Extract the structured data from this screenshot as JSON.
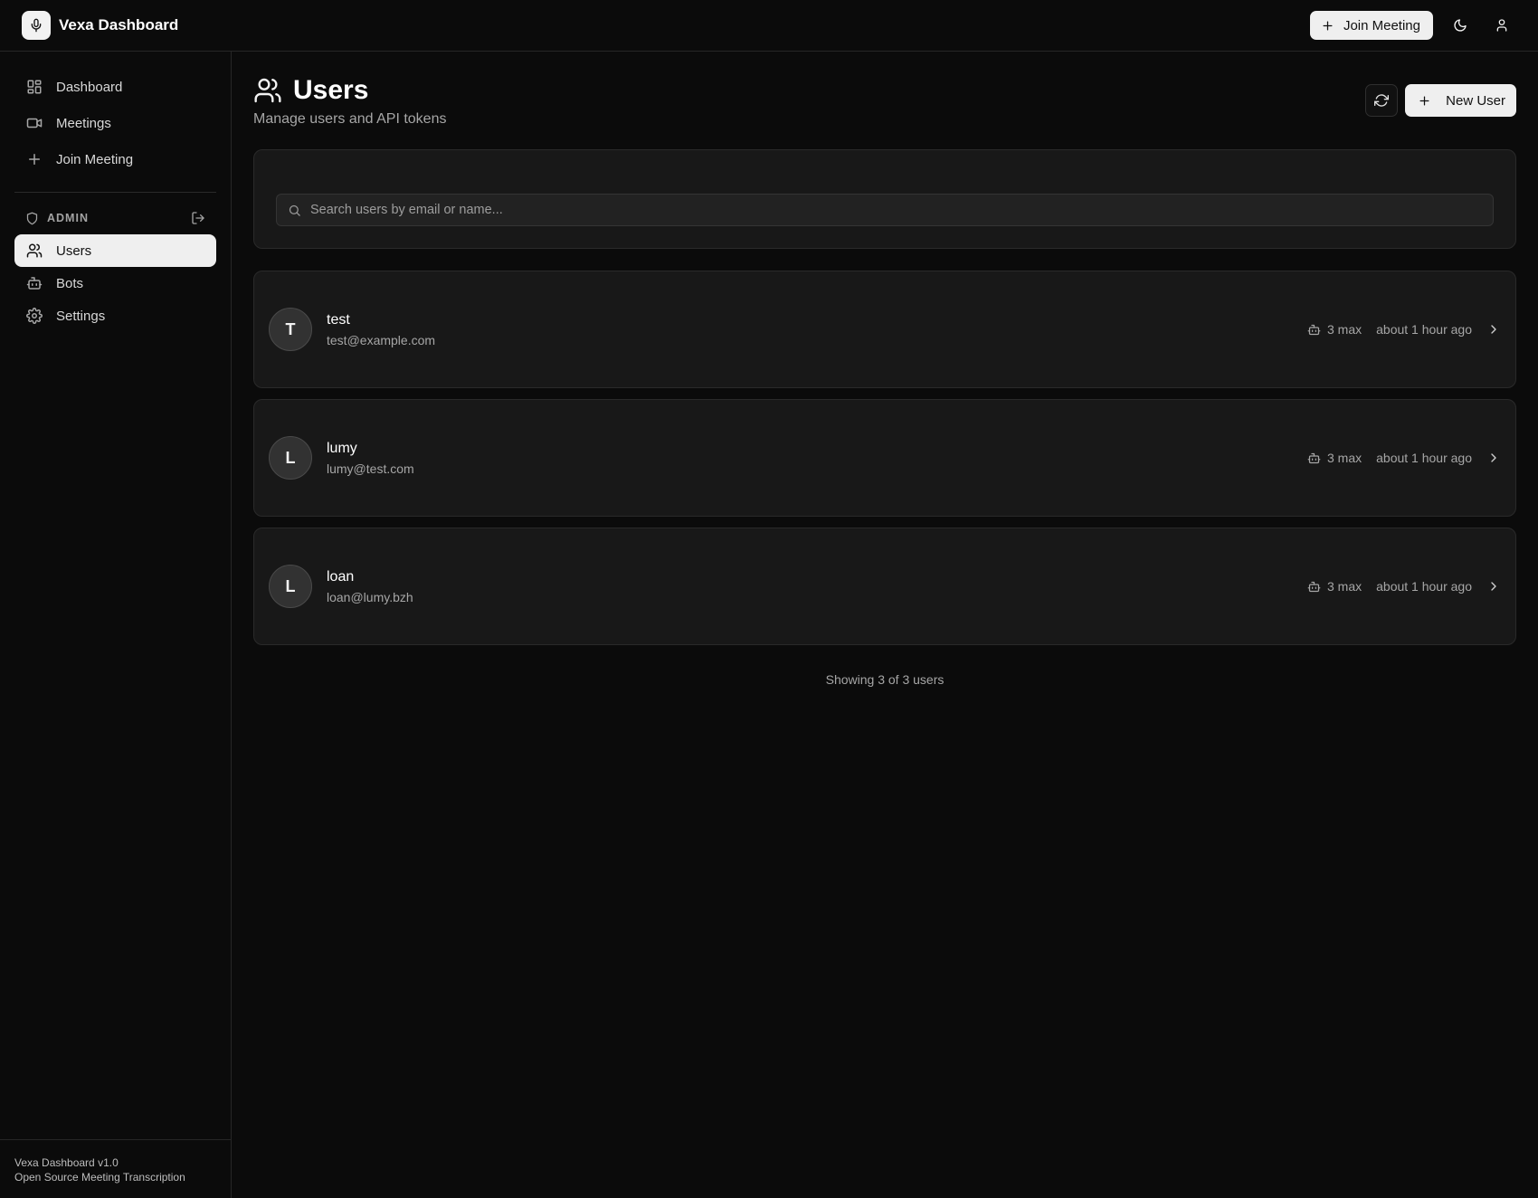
{
  "header": {
    "app_title": "Vexa Dashboard",
    "logo_icon": "microphone-icon",
    "join_meeting_label": "Join Meeting",
    "theme_icon": "moon-icon",
    "user_icon": "user-icon"
  },
  "sidebar": {
    "items": [
      {
        "label": "Dashboard",
        "icon": "dashboard-icon"
      },
      {
        "label": "Meetings",
        "icon": "video-icon"
      },
      {
        "label": "Join Meeting",
        "icon": "plus-icon"
      }
    ],
    "admin_label": "ADMIN",
    "admin_items": [
      {
        "label": "Users",
        "icon": "users-icon",
        "active": true
      },
      {
        "label": "Bots",
        "icon": "bot-icon"
      },
      {
        "label": "Settings",
        "icon": "gear-icon"
      }
    ],
    "footer": {
      "version": "Vexa Dashboard v1.0",
      "tagline": "Open Source Meeting Transcription"
    }
  },
  "page": {
    "title": "Users",
    "subtitle": "Manage users and API tokens",
    "new_user_label": "New User",
    "search": {
      "placeholder": "Search users by email or name...",
      "value": ""
    },
    "users": [
      {
        "initial": "T",
        "name": "test",
        "email": "test@example.com",
        "bots": "3 max",
        "created": "about 1 hour ago"
      },
      {
        "initial": "L",
        "name": "lumy",
        "email": "lumy@test.com",
        "bots": "3 max",
        "created": "about 1 hour ago"
      },
      {
        "initial": "L",
        "name": "loan",
        "email": "loan@lumy.bzh",
        "bots": "3 max",
        "created": "about 1 hour ago"
      }
    ],
    "showing": "Showing 3 of 3 users"
  }
}
